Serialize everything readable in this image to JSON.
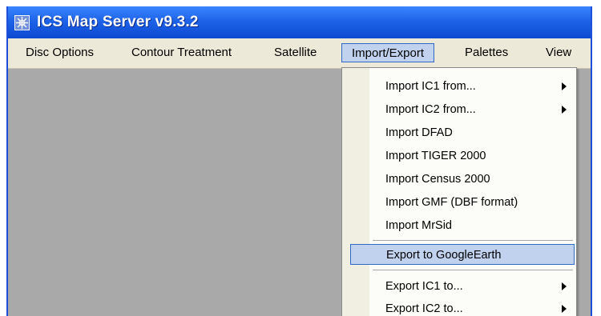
{
  "window": {
    "title": "ICS Map Server v9.3.2",
    "app_icon": "app-map-icon"
  },
  "menubar": {
    "items": [
      {
        "label": "Disc Options"
      },
      {
        "label": "Contour Treatment"
      },
      {
        "label": "Satellite"
      },
      {
        "label": "Import/Export"
      },
      {
        "label": "Palettes"
      },
      {
        "label": "View"
      }
    ],
    "active": "Import/Export"
  },
  "dropdown": {
    "items": [
      {
        "label": "Import IC1 from...",
        "submenu": true
      },
      {
        "label": "Import IC2 from...",
        "submenu": true
      },
      {
        "label": "Import DFAD",
        "submenu": false
      },
      {
        "label": "Import TIGER 2000",
        "submenu": false
      },
      {
        "label": "Import Census 2000",
        "submenu": false
      },
      {
        "label": "Import GMF (DBF format)",
        "submenu": false
      },
      {
        "label": "Import MrSid",
        "submenu": false
      },
      {
        "label": "Export to GoogleEarth",
        "submenu": false,
        "highlighted": true
      },
      {
        "label": "Export IC1 to...",
        "submenu": true
      },
      {
        "label": "Export IC2 to...",
        "submenu": true
      }
    ]
  },
  "colors": {
    "titlebar": "#1e63e8",
    "menubar": "#ece9d8",
    "highlight": "#c1d2ee",
    "workspace": "#a9a9a9"
  }
}
